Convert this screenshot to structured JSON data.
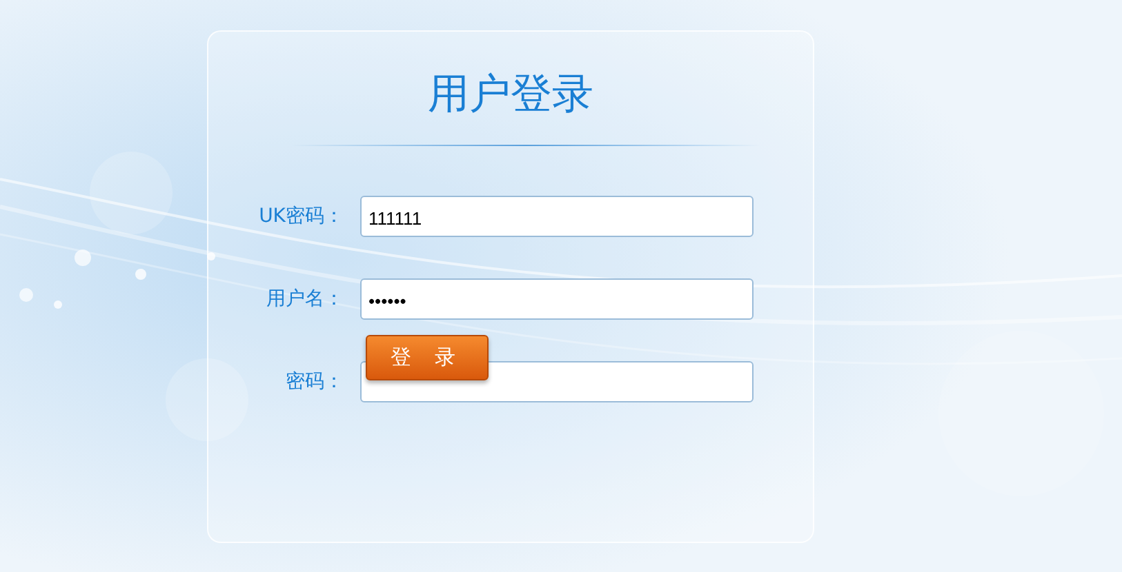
{
  "title": "用户登录",
  "fields": [
    {
      "label": "UK密码：",
      "value": "111111"
    },
    {
      "label": "用户名：",
      "value": "••••••"
    },
    {
      "label": "密码："
    }
  ],
  "login_button": "登 录"
}
